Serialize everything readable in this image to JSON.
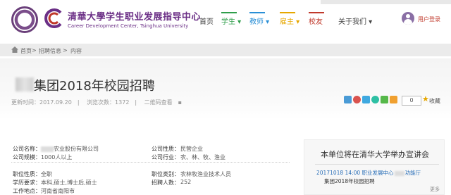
{
  "header": {
    "title": "清華大學学生职业发展指导中心",
    "subtitle": "Career Development Center, Tsinghua University",
    "nav": [
      {
        "label": "首页",
        "color": "#444444"
      },
      {
        "label": "学生",
        "color": "#2e9e4a",
        "has_menu": true
      },
      {
        "label": "教师",
        "color": "#2a8fd6",
        "has_menu": true
      },
      {
        "label": "雇主",
        "color": "#e6a700",
        "has_menu": true
      },
      {
        "label": "校友",
        "color": "#c0392b"
      },
      {
        "label": "关于我们",
        "color": "#444444",
        "has_menu": true
      }
    ],
    "user_login": "用户登录",
    "brand_color": "#6b2f86"
  },
  "breadcrumb": [
    "首页",
    "招聘信息",
    "内容"
  ],
  "article": {
    "title": "集团2018年校园招聘",
    "updated": "更新时间：2017.09.20",
    "views": "浏览次数：1372",
    "qr": "二维码查看",
    "fav_count": "0",
    "fav_label": "收藏"
  },
  "details": {
    "left": [
      {
        "label": "公司名称：",
        "value": "农业股份有限公司"
      },
      {
        "label": "公司规模：",
        "value": "1000人以上"
      },
      {
        "label": "职位性质：",
        "value": "全职"
      },
      {
        "label": "学历要求：",
        "value": "本科,硕士,博士后,硕士"
      },
      {
        "label": "工作地点：",
        "value": "河南省南阳市"
      }
    ],
    "right": [
      {
        "label": "公司性质：",
        "value": "民营企业"
      },
      {
        "label": "公司行业：",
        "value": "农、林、牧、渔业"
      },
      {
        "label": "职位类别：",
        "value": "农林牧渔业技术人员"
      },
      {
        "label": "招聘人数：",
        "value": "252"
      }
    ]
  },
  "panel": {
    "title": "本单位将在清华大学举办宣讲会",
    "item_date": "20171018  14:00  职业发展中心",
    "item_place": "功能厅",
    "item_name": "集团2018年校园招聘",
    "more": "更多"
  }
}
